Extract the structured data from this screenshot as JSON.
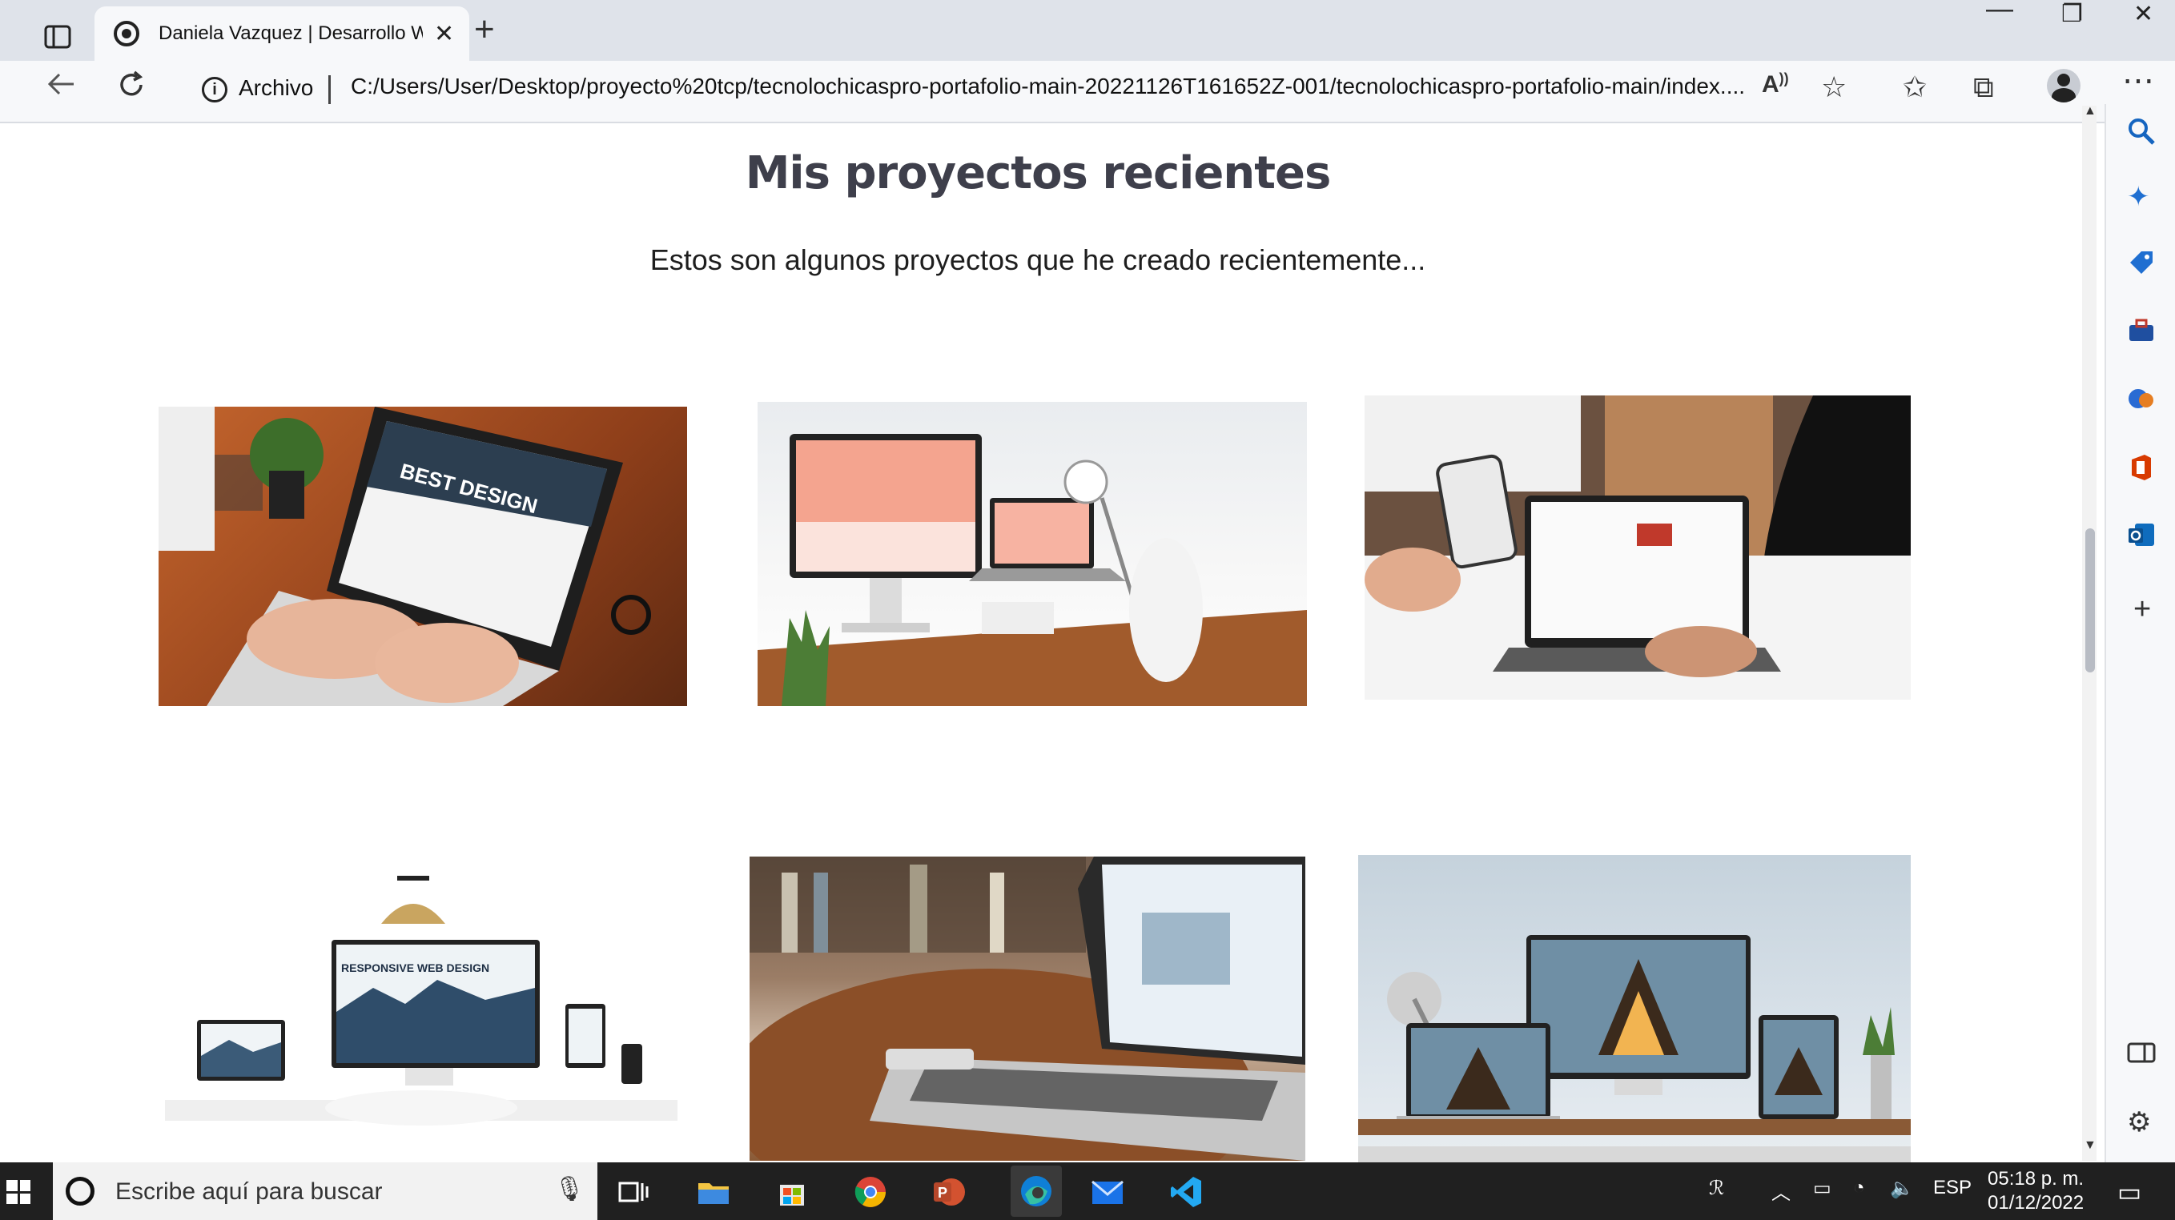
{
  "browser": {
    "tab_title": "Daniela Vazquez | Desarrollo Web",
    "new_tab": "+",
    "close_tab": "✕",
    "site_info_label": "Archivo",
    "url": "C:/Users/User/Desktop/proyecto%20tcp/tecnolochicaspro-portafolio-main-20221126T161652Z-001/tecnolochicaspro-portafolio-main/index....",
    "window_controls": [
      "—",
      "❐",
      "✕"
    ],
    "toolbar_icons": [
      "read-aloud-icon",
      "add-favorite-icon",
      "favorites-icon",
      "collections-icon",
      "profile-icon",
      "more-icon"
    ]
  },
  "page": {
    "heading": "Mis proyectos recientes",
    "subtitle": "Estos son algunos proyectos que he creado recientemente...",
    "projects": [
      {
        "alt": "laptop-best-design-photo"
      },
      {
        "alt": "desk-computer-setup-photo"
      },
      {
        "alt": "phone-and-laptop-photo"
      },
      {
        "alt": "responsive-web-design-photo"
      },
      {
        "alt": "laptop-bookshelf-photo"
      },
      {
        "alt": "architect-studio-devices-photo"
      }
    ],
    "image_texts": {
      "best_design": "BEST DESIGN",
      "responsive": "RESPONSIVE WEB DESIGN"
    }
  },
  "sidebar": {
    "icons": [
      "search-icon",
      "copilot-icon",
      "shopping-icon",
      "tools-icon",
      "games-icon",
      "office-icon",
      "outlook-icon",
      "add-icon",
      "split-screen-icon",
      "settings-icon"
    ]
  },
  "taskbar": {
    "search_placeholder": "Escribe aquí para buscar",
    "apps": [
      "task-view",
      "file-explorer",
      "store",
      "chrome",
      "powerpoint",
      "edge",
      "mail",
      "vscode"
    ],
    "language": "ESP",
    "time": "05:18 p. m.",
    "date": "01/12/2022"
  },
  "colors": {
    "heading": "#3e3f4b",
    "taskbar": "#202020",
    "accent": "#0078d4"
  }
}
